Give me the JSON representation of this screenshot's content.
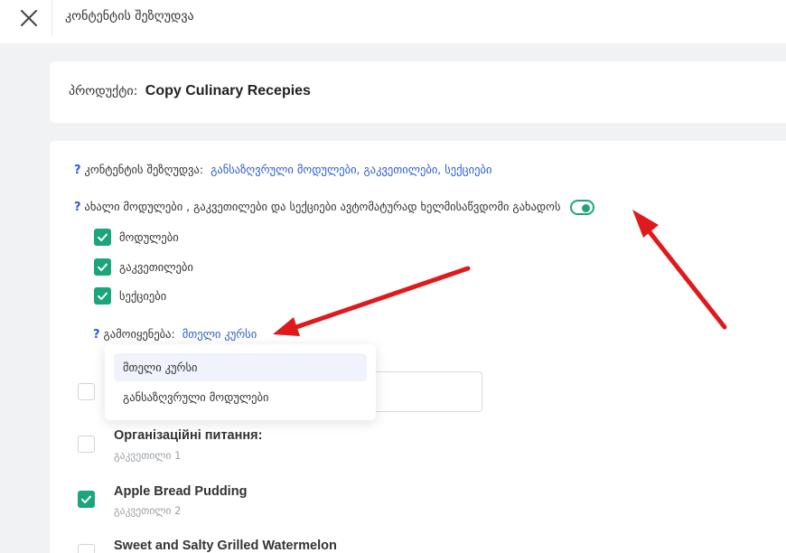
{
  "header": {
    "title": "კონტენტის შეზღუდვა"
  },
  "product": {
    "label": "პროდუქტი:",
    "name": "Copy Culinary Recepies"
  },
  "restriction": {
    "label": "კონტენტის შეზღუდვა:",
    "value": "განსაზღვრული მოდულები, გაკვეთილები, სექციები"
  },
  "auto_available": {
    "label": "ახალი მოდულები , გაკვეთილები და სექციები ავტომატურად ხელმისაწვდომი გახადოს",
    "enabled": true
  },
  "options": [
    {
      "label": "მოდულები",
      "checked": true
    },
    {
      "label": "გაკვეთილები",
      "checked": true
    },
    {
      "label": "სექციები",
      "checked": true
    }
  ],
  "apply_to": {
    "label": "გამოიყენება:",
    "value": "მთელი კურსი",
    "dropdown": [
      "მთელი კურსი",
      "განსაზღვრული მოდულები"
    ]
  },
  "lessons": [
    {
      "title": "Організаційні питання:",
      "sub": "გაკვეთილი 1",
      "checked": false
    },
    {
      "title": "Apple Bread Pudding",
      "sub": "გაკვეთილი 2",
      "checked": true
    },
    {
      "title": "Sweet and Salty Grilled Watermelon",
      "sub": "",
      "checked": false
    }
  ],
  "colors": {
    "accent": "#1aa57a",
    "link": "#2a5bd7",
    "annotation": "#e0191c"
  }
}
